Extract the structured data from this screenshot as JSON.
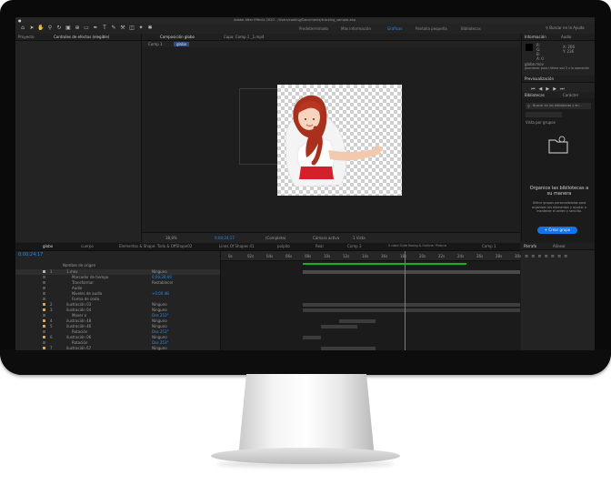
{
  "window": {
    "title": "Adobe After Effects 2020 - /Users/cooling/Documents/tracking_sample.aep"
  },
  "menubar": {
    "left_icon": "apple-logo"
  },
  "toolbar": {
    "tools": [
      "home-icon",
      "arrow-icon",
      "hand-icon",
      "zoom-icon",
      "rotate-icon",
      "camera-icon",
      "pan-icon",
      "rectangle-icon",
      "pen-icon",
      "type-icon",
      "brush-icon",
      "stamp-icon",
      "eraser-icon",
      "roto-icon",
      "pin-icon"
    ],
    "workspaces": [
      "Predeterminado",
      "Bibliotecas",
      "Alinear",
      "Pantalla pequeña",
      "Bibliotecas"
    ],
    "workspace_visible": [
      "Predeterminado",
      "Más información",
      "Gráficos",
      "Pantalla pequeña",
      "Bibliotecas"
    ],
    "active_workspace": "Gráficos",
    "search_label": "Buscar en la Ayuda"
  },
  "left_panel": {
    "tabs": [
      "Proyecto",
      "Controles de efectos (elegible)"
    ]
  },
  "viewer": {
    "tab": "Composición globo",
    "breadcrumbs": [
      "Comp 1",
      "globo"
    ],
    "second_tab": "Capa: Comp 1 _1.mp4",
    "zoom": "38,8%",
    "timecode": "0;00;24;17",
    "resolution": "(Completa)",
    "camera": "Cámara activa",
    "views": "1 Vista"
  },
  "right_panel": {
    "info_tab": "Información",
    "audio_tab": "Audio",
    "info_values": [
      "R:",
      "G:",
      "B:",
      "A: 0",
      "X: 266",
      "Y: 236"
    ],
    "info_text": "globo.mov",
    "info_sub": "guardado: para Última vez 2 s la operación",
    "preview_tab": "Previsualización",
    "libraries_tab": "Bibliotecas",
    "libraries_tab2": "Carácter",
    "search_placeholder": "Buscar en las bibliotecas y en...",
    "library_select": "Vista por grupos",
    "lib_heading": "Organice las bibliotecas a su manera",
    "lib_body": "Utilice grupos personalizados para organizar los elementos y ayudar a mantener el orden y sencillo.",
    "lib_button": "+ Crear grupo"
  },
  "timeline": {
    "tabs": [
      "globo",
      "cuerpo",
      "Elementos & Shape: Todo & OffShape02",
      "Lines Of Shapes 41",
      "pulpito",
      "Real",
      "Comp 3",
      "5 cabe Suite Backg & Outline: Pintura",
      "Comp 1"
    ],
    "active_tab": "globo",
    "timecode": "0;00;24;17",
    "header": "Nombre de origen",
    "layer_rows": [
      {
        "num": "1",
        "name": "1.mov",
        "mode": "Ninguno",
        "color": "#b3b3b3"
      },
      {
        "num": "",
        "name": "Marcador de tiempo",
        "mode": "0;00;20;00",
        "color": "#555555"
      },
      {
        "num": "",
        "name": "Transformar",
        "mode": "Restablecer",
        "color": "#555555"
      },
      {
        "num": "",
        "name": "Audio",
        "mode": "",
        "color": "#555555"
      },
      {
        "num": "",
        "name": "Niveles de audio",
        "mode": "+0,00 dB",
        "color": "#555555"
      },
      {
        "num": "",
        "name": "Forma de onda",
        "mode": "",
        "color": "#555555"
      },
      {
        "num": "2",
        "name": "ilustración 03",
        "mode": "Ninguno",
        "color": "#e7a13d"
      },
      {
        "num": "3",
        "name": "ilustración 04",
        "mode": "Ninguno",
        "color": "#e7a13d"
      },
      {
        "num": "",
        "name": "Mover x",
        "mode": "Dos 253°",
        "color": "#555555"
      },
      {
        "num": "4",
        "name": "ilustración 48",
        "mode": "Ninguno",
        "color": "#e7a13d"
      },
      {
        "num": "5",
        "name": "ilustración 46",
        "mode": "Ninguno",
        "color": "#e7a13d"
      },
      {
        "num": "",
        "name": "Rotación",
        "mode": "Dos 253°",
        "color": "#555555"
      },
      {
        "num": "6",
        "name": "ilustración 06",
        "mode": "Ninguno",
        "color": "#e7a13d"
      },
      {
        "num": "",
        "name": "Rotación",
        "mode": "Dos 253°",
        "color": "#555555"
      },
      {
        "num": "7",
        "name": "ilustración 67",
        "mode": "Ninguno",
        "color": "#e7a13d"
      }
    ],
    "ruler_labels": [
      "0s",
      "02s",
      "04s",
      "06s",
      "08s",
      "10s",
      "12s",
      "14s",
      "16s",
      "18s",
      "20s",
      "22s",
      "24s",
      "26s",
      "28s",
      "30s"
    ]
  },
  "bottom_right": {
    "tab1": "Párrafo",
    "tab2": "Alinear"
  }
}
